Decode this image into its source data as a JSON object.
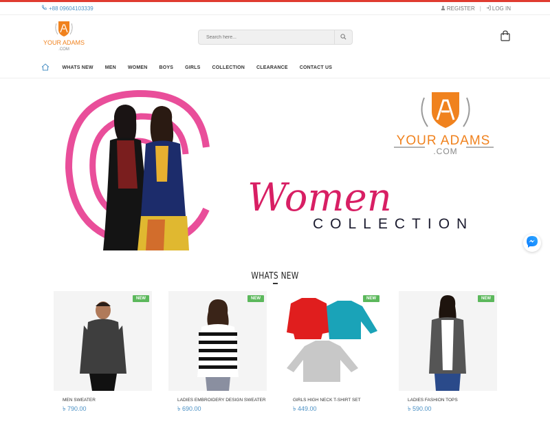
{
  "topbar": {
    "phone": "+88 09604103339",
    "register": "REGISTER",
    "login": "LOG IN"
  },
  "logo": {
    "line1": "YOUR ADAMS",
    "line2": ".COM"
  },
  "search": {
    "placeholder": "Search here..."
  },
  "nav": {
    "items": [
      "WHATS NEW",
      "MEN",
      "WOMEN",
      "BOYS",
      "GIRLS",
      "COLLECTION",
      "CLEARANCE",
      "CONTACT US"
    ]
  },
  "banner": {
    "brand_line1": "YOUR ADAMS",
    "brand_line2": ".COM",
    "script_word": "Women",
    "collection_word": "COLLECTION"
  },
  "section": {
    "title": "WHATS NEW"
  },
  "products": [
    {
      "name": "MEN SWEATER",
      "price": "৳ 790.00",
      "badge": "NEW"
    },
    {
      "name": "LADIES EMBROIDERY DESIGN SWEATER",
      "price": "৳ 690.00",
      "badge": "NEW"
    },
    {
      "name": "GIRLS HIGH NECK T-SHIRT SET",
      "price": "৳ 449.00",
      "badge": "NEW"
    },
    {
      "name": "LADIES FASHION TOPS",
      "price": "৳ 590.00",
      "badge": "NEW"
    }
  ],
  "colors": {
    "accent": "#e03c31",
    "link": "#4a90c4",
    "badge": "#5cb85c",
    "pink": "#e0307a",
    "orange": "#f0821e"
  }
}
